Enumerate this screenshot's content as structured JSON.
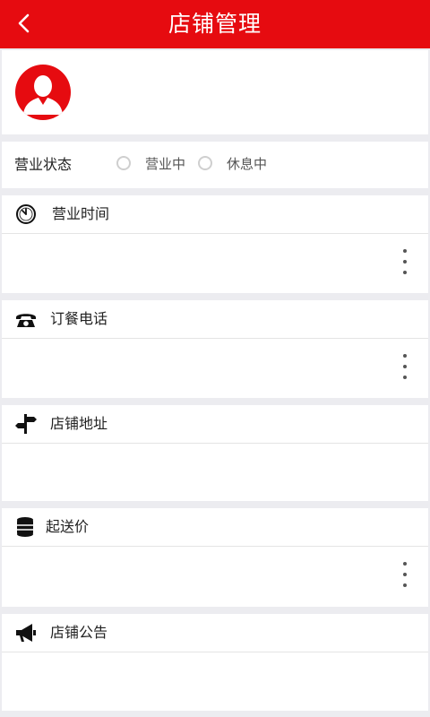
{
  "header": {
    "title": "店铺管理"
  },
  "status": {
    "label": "营业状态",
    "options": [
      "营业中",
      "休息中"
    ]
  },
  "sections": [
    {
      "title": "营业时间",
      "icon": "clock-icon",
      "has_more": true
    },
    {
      "title": "订餐电话",
      "icon": "phone-icon",
      "has_more": true
    },
    {
      "title": "店铺地址",
      "icon": "signpost-icon",
      "has_more": false
    },
    {
      "title": "起送价",
      "icon": "coins-stack-icon",
      "has_more": true
    },
    {
      "title": "店铺公告",
      "icon": "megaphone-icon",
      "has_more": false
    }
  ],
  "colors": {
    "brand": "#e60b10",
    "background": "#ececf0"
  }
}
